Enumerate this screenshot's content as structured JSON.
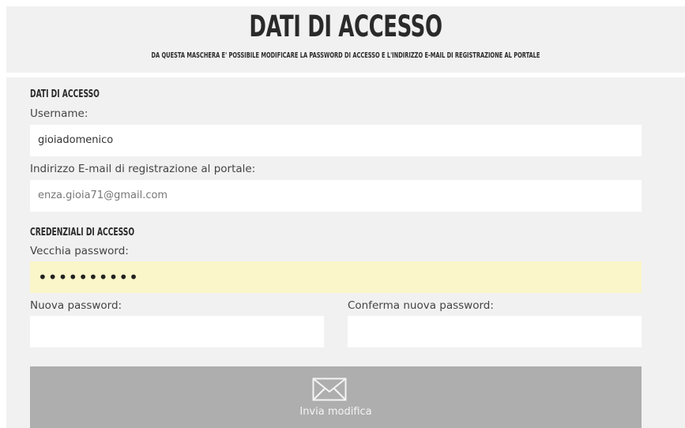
{
  "header": {
    "title": "DATI DI ACCESSO",
    "subtitle": "DA QUESTA MASCHERA E' POSSIBILE MODIFICARE LA PASSWORD DI ACCESSO E L'INDIRIZZO E-MAIL DI REGISTRAZIONE AL PORTALE"
  },
  "account_section": {
    "title": "DATI DI ACCESSO",
    "username_label": "Username:",
    "username_value": "gioiadomenico",
    "email_label": "Indirizzo E-mail di registrazione al portale:",
    "email_value": "enza.gioia71@gmail.com"
  },
  "credentials_section": {
    "title": "CREDENZIALI DI ACCESSO",
    "old_password_label": "Vecchia password:",
    "old_password_value": "••••••••••",
    "new_password_label": "Nuova password:",
    "new_password_value": "",
    "confirm_password_label": "Conferma nuova password:",
    "confirm_password_value": ""
  },
  "submit": {
    "label": "Invia modifica",
    "icon": "envelope-icon"
  },
  "colors": {
    "panel_background": "#f1f1f1",
    "autofill_background": "#fbf6c9",
    "button_background": "#aeaeae"
  }
}
